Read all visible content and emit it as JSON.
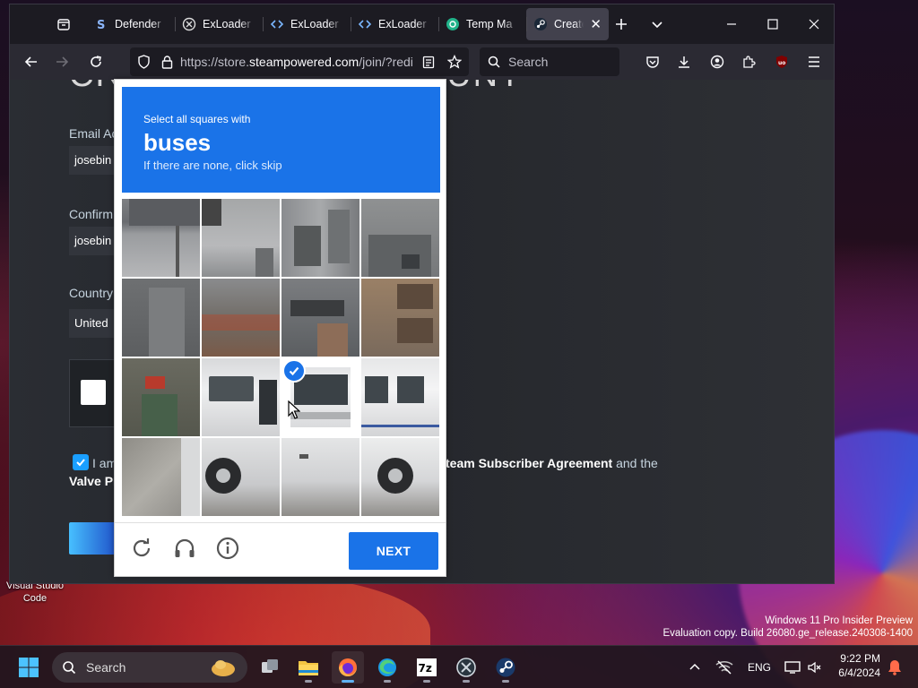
{
  "desktop": {
    "icon_label": "Visual Studio Code",
    "watermark_line1": "Windows 11 Pro Insider Preview",
    "watermark_line2": "Evaluation copy. Build 26080.ge_release.240308-1400"
  },
  "browser": {
    "tabs": [
      {
        "title": "Defender",
        "favicon": "defender-s-icon"
      },
      {
        "title": "ExLoader",
        "favicon": "exloader-icon"
      },
      {
        "title": "ExLoader",
        "favicon": "code-brackets-icon"
      },
      {
        "title": "ExLoader",
        "favicon": "code-brackets-icon"
      },
      {
        "title": "Temp Ma",
        "favicon": "temp-mail-icon"
      },
      {
        "title": "Create",
        "favicon": "steam-icon",
        "active": true
      }
    ],
    "url_prefix": "https://store.",
    "url_domain": "steampowered.com",
    "url_suffix": "/join/?redi",
    "search_placeholder": "Search"
  },
  "steam_page": {
    "heading": "CREATE YOUR ACCOUNT",
    "email_label": "Email Ac",
    "email_value": "josebin",
    "confirm_label": "Confirm",
    "confirm_value": "josebin",
    "country_label": "Country",
    "country_value": "United",
    "agree_prefix": "I am",
    "agree_link1": "team Subscriber Agreement",
    "agree_mid": " and the",
    "agree_link2": "Valve Pr"
  },
  "recaptcha": {
    "instruction": "Select all squares with",
    "target": "buses",
    "hint": "If there are none, click skip",
    "next_label": "NEXT",
    "selected_tiles": [
      10
    ]
  },
  "taskbar": {
    "search_label": "Search",
    "language": "ENG",
    "time": "9:22 PM",
    "date": "6/4/2024"
  },
  "colors": {
    "recaptcha_blue": "#1a73e8",
    "steam_blue": "#1a9fff",
    "browser_dark": "#1c1b22"
  }
}
